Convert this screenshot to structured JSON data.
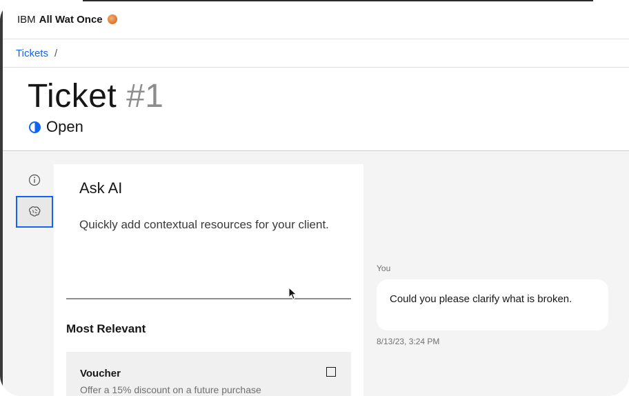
{
  "header": {
    "brand_prefix": "IBM",
    "brand_name": "All Wat Once"
  },
  "breadcrumb": {
    "link_label": "Tickets",
    "separator": "/"
  },
  "ticket": {
    "title_word": "Ticket",
    "title_number": "#1",
    "status": "Open",
    "status_icon": "half-circle-status-icon"
  },
  "sidebar": {
    "icons": [
      "information-icon",
      "ai-brain-icon"
    ],
    "active": "ai-brain-icon"
  },
  "ask_ai": {
    "title": "Ask AI",
    "description": "Quickly add contextual resources for your client.",
    "section_title": "Most Relevant",
    "cards": [
      {
        "title": "Voucher",
        "description": "Offer a 15% discount on a future purchase"
      }
    ]
  },
  "chat": {
    "messages": [
      {
        "author": "You",
        "text": "Could you please clarify what is broken.",
        "timestamp": "8/13/23, 3:24 PM"
      }
    ]
  },
  "colors": {
    "accent": "#0f62fe",
    "background": "#f4f4f4",
    "surface": "#ffffff"
  }
}
